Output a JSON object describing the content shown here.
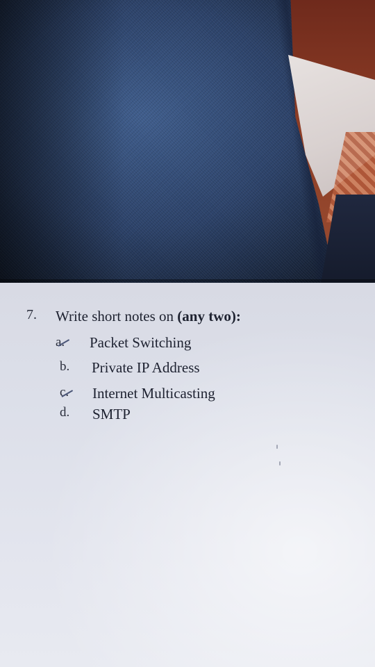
{
  "question": {
    "number": "7.",
    "title_prefix": "Write short notes on ",
    "title_emphasis": "(any two):"
  },
  "items": [
    {
      "letter": "a.",
      "text": "Packet Switching"
    },
    {
      "letter": "b.",
      "text": "Private IP Address"
    },
    {
      "letter": "c.",
      "text": "Internet Multicasting"
    },
    {
      "letter": "d.",
      "text": "SMTP"
    }
  ]
}
